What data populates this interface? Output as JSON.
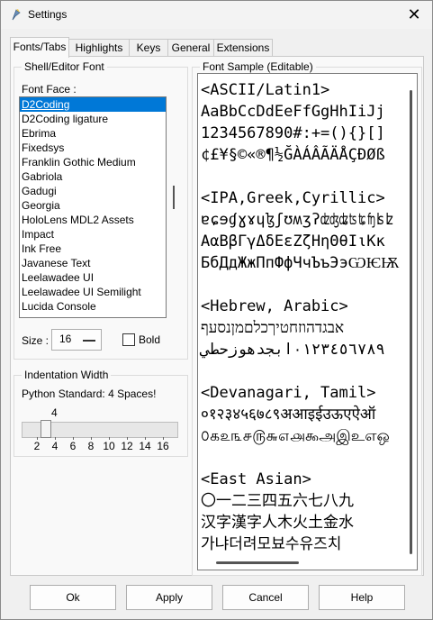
{
  "window": {
    "title": "Settings"
  },
  "tabs": [
    "Fonts/Tabs",
    "Highlights",
    "Keys",
    "General",
    "Extensions"
  ],
  "shell_editor_font": {
    "group_label": "Shell/Editor Font",
    "font_face_label": "Font Face :",
    "fonts": [
      "D2Coding",
      "D2Coding ligature",
      "Ebrima",
      "Fixedsys",
      "Franklin Gothic Medium",
      "Gabriola",
      "Gadugi",
      "Georgia",
      "HoloLens MDL2 Assets",
      "Impact",
      "Ink Free",
      "Javanese Text",
      "Leelawadee UI",
      "Leelawadee UI Semilight",
      "Lucida Console"
    ],
    "selected_font": "D2Coding",
    "size_label": "Size :",
    "size_value": "16",
    "bold_label": "Bold",
    "bold_checked": false
  },
  "indentation": {
    "group_label": "Indentation Width",
    "python_standard": "Python Standard: 4 Spaces!",
    "current_value": "4",
    "tick_labels": [
      "2",
      "4",
      "6",
      "8",
      "10",
      "12",
      "14",
      "16"
    ]
  },
  "font_sample": {
    "group_label": "Font Sample (Editable)",
    "text": "<ASCII/Latin1>\nAaBbCcDdEeFfGgHhIiJj\n1234567890#:+=(){}[]\n¢£¥§©«®¶½ĞÀÁÂÃÄÅÇÐØß\n\n<IPA,Greek,Cyrillic>\nɐɕɘɠɣɤɥɮʃʊʍʒʔʣʤʥʦʨʩʪʫ\nΑαΒβΓγΔδΕεΖζΗηΘθΙιΚκ\nБбДдЖжПпФфЧчЪъЭэѠѤѬ\n\n<Hebrew, Arabic>\nאבגדהוזחטיךכלםמןנסעף\n٠١٢٣٤٥٦٧٨٩ابجدهوزحطي\n\n<Devanagari, Tamil>\n०१२३४५६७८९अआइईउऊएऐऑ\n௦௧௨௩௪௫௬௭௮௯அஇஉஎஒ\n\n<East Asian>\n〇一二三四五六七八九\n汉字漢字人木火土金水\n가냐더려모뵤수유즈치"
  },
  "buttons": {
    "ok": "Ok",
    "apply": "Apply",
    "cancel": "Cancel",
    "help": "Help"
  },
  "icons": {
    "app": "python-feather-icon",
    "close": "close-icon"
  },
  "colors": {
    "selection": "#0078d7",
    "window_bg": "#f0f0f0",
    "panel_bg": "#f9f9f9"
  }
}
